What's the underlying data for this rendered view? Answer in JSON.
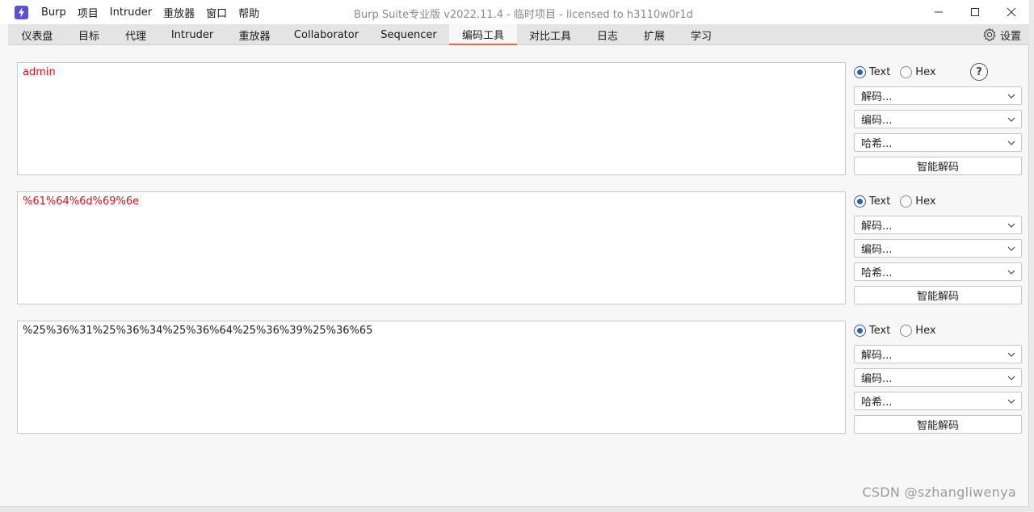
{
  "window": {
    "title": "Burp Suite专业版  v2022.11.4 - 临时项目 - licensed to h3110w0r1d"
  },
  "menu": [
    "Burp",
    "项目",
    "Intruder",
    "重放器",
    "窗口",
    "帮助"
  ],
  "tabs": [
    "仪表盘",
    "目标",
    "代理",
    "Intruder",
    "重放器",
    "Collaborator",
    "Sequencer",
    "编码工具",
    "对比工具",
    "日志",
    "扩展",
    "学习"
  ],
  "active_tab": "编码工具",
  "settings_label": "设置",
  "panels": [
    {
      "content": "admin",
      "radio_text": "Text",
      "radio_hex": "Hex",
      "selected": "Text",
      "decode": "解码...",
      "encode": "编码...",
      "hash": "哈希...",
      "smart_decode": "智能解码"
    },
    {
      "content": "%61%64%6d%69%6e",
      "radio_text": "Text",
      "radio_hex": "Hex",
      "selected": "Text",
      "decode": "解码...",
      "encode": "编码...",
      "hash": "哈希...",
      "smart_decode": "智能解码"
    },
    {
      "content": "%25%36%31%25%36%34%25%36%64%25%36%39%25%36%65",
      "radio_text": "Text",
      "radio_hex": "Hex",
      "selected": "Text",
      "decode": "解码...",
      "encode": "编码...",
      "hash": "哈希...",
      "smart_decode": "智能解码"
    }
  ],
  "help_label": "?",
  "watermark": "CSDN @szhangliwenya",
  "colors": {
    "accent_tab": "#e8664a",
    "modified_text": "#d0141a",
    "radio": "#2b5fb0",
    "app_icon": "#5b4fd6"
  },
  "icons": {
    "app": "burp-lightning-icon",
    "settings": "gear-icon",
    "help": "question-circle-icon",
    "minimize": "minimize-icon",
    "maximize": "maximize-icon",
    "close": "close-icon",
    "caret": "chevron-down-icon"
  }
}
